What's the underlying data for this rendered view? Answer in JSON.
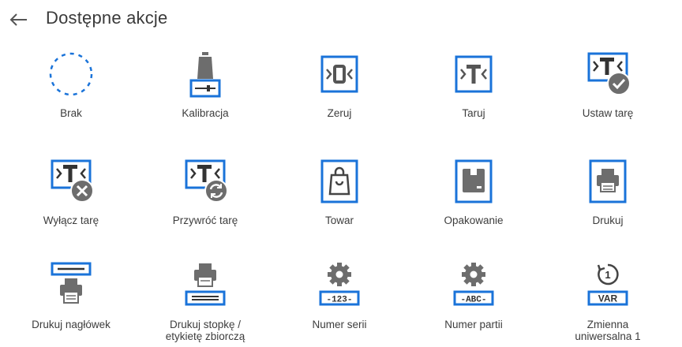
{
  "header": {
    "title": "Dostępne akcje",
    "back_icon": "arrow-left-icon"
  },
  "colors": {
    "accent": "#1a73d9",
    "icon_gray": "#6d6d6d",
    "text": "#3d3d3d"
  },
  "actions": [
    {
      "label": "Brak",
      "icon": "empty-circle-icon"
    },
    {
      "label": "Kalibracja",
      "icon": "calibration-weight-icon"
    },
    {
      "label": "Zeruj",
      "icon": "zero-icon"
    },
    {
      "label": "Taruj",
      "icon": "tare-icon"
    },
    {
      "label": "Ustaw tarę",
      "icon": "set-tare-icon"
    },
    {
      "label": "Wyłącz tarę",
      "icon": "disable-tare-icon"
    },
    {
      "label": "Przywróć tarę",
      "icon": "restore-tare-icon"
    },
    {
      "label": "Towar",
      "icon": "product-bag-icon"
    },
    {
      "label": "Opakowanie",
      "icon": "packaging-box-icon"
    },
    {
      "label": "Drukuj",
      "icon": "print-icon"
    },
    {
      "label": "Drukuj nagłówek",
      "icon": "print-header-icon"
    },
    {
      "label": "Drukuj stopkę /\netykietę zbiorczą",
      "icon": "print-footer-icon",
      "badge": ""
    },
    {
      "label": "Numer serii",
      "icon": "serial-number-icon",
      "badge": "-123-"
    },
    {
      "label": "Numer partii",
      "icon": "batch-number-icon",
      "badge": "-ABC-"
    },
    {
      "label": "Zmienna\nuniwersalna 1",
      "icon": "universal-variable-icon",
      "badge": "VAR",
      "circle": "1"
    }
  ]
}
